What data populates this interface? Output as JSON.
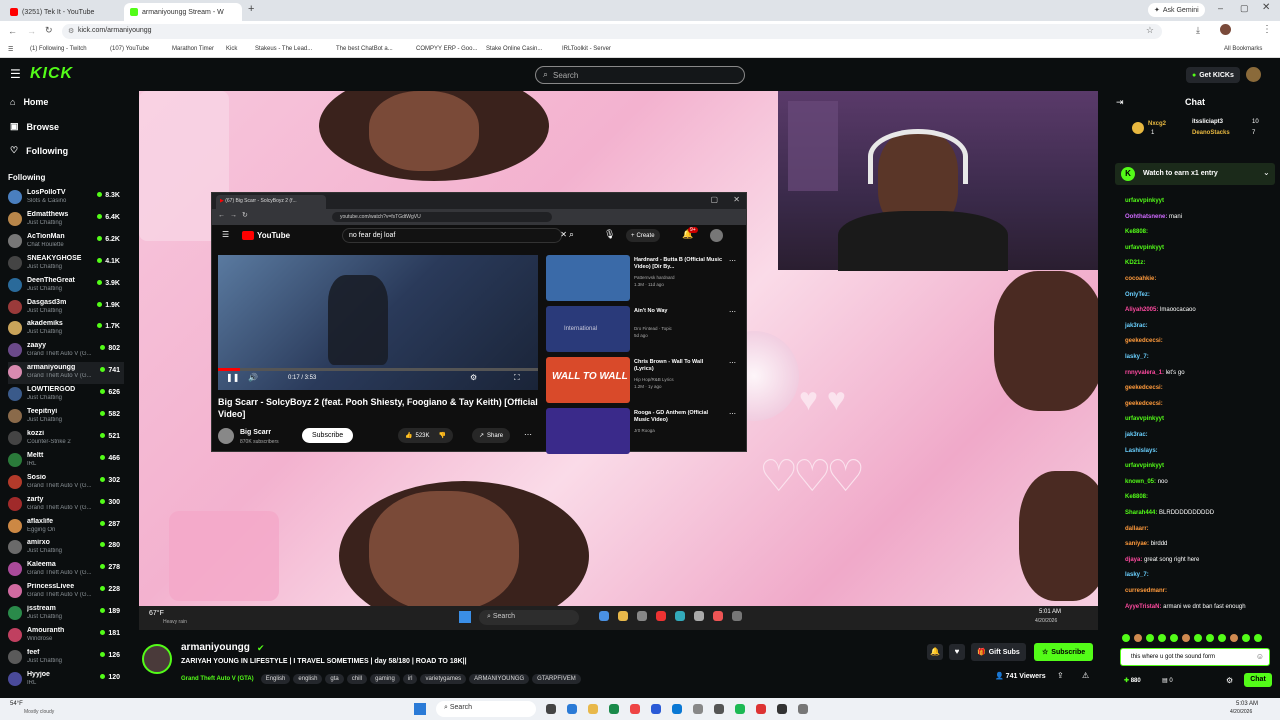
{
  "browser": {
    "tabs": [
      {
        "label": "(3251) Tek It - YouTube"
      },
      {
        "label": "armaniyoungg Stream - W"
      }
    ],
    "new_tab": "+",
    "ask_gemini": "Ask Gemini",
    "url": "kick.com/armaniyoungg",
    "bookmarks": [
      "(1) Following - Twitch",
      "(107) YouTube",
      "Marathon Timer",
      "Kick",
      "Stakeus - The Lead...",
      "The best ChatBot a...",
      "COMPYY ERP - Goo...",
      "Stake Online Casin...",
      "IRLToolkit - Server"
    ],
    "all_bookmarks": "All Bookmarks"
  },
  "kick": {
    "logo": "KICK",
    "search_placeholder": "Search",
    "get_kicks": "Get KICKs"
  },
  "sidebar": {
    "nav": [
      {
        "label": "Home",
        "icon": "home-icon"
      },
      {
        "label": "Browse",
        "icon": "browse-icon"
      },
      {
        "label": "Following",
        "icon": "heart-icon"
      }
    ],
    "following_title": "Following",
    "channels": [
      {
        "name": "LosPolloTV",
        "game": "Slots & Casino",
        "viewers": "8.3K",
        "color": "#4a7fbf"
      },
      {
        "name": "Edmatthews",
        "game": "Just Chatting",
        "viewers": "6.4K",
        "color": "#b8864a"
      },
      {
        "name": "AcTionMan",
        "game": "Chat Roulette",
        "viewers": "6.2K",
        "color": "#777"
      },
      {
        "name": "SNEAKYGHOSE",
        "game": "Just Chatting",
        "viewers": "4.1K",
        "color": "#444"
      },
      {
        "name": "DeenTheGreat",
        "game": "Just Chatting",
        "viewers": "3.9K",
        "color": "#2a6a9a"
      },
      {
        "name": "Dasgasd3m",
        "game": "Just Chatting",
        "viewers": "1.9K",
        "color": "#9a3a3a"
      },
      {
        "name": "akademiks",
        "game": "Just Chatting",
        "viewers": "1.7K",
        "color": "#c9a45a"
      },
      {
        "name": "zaayy",
        "game": "Grand Theft Auto V (G...",
        "viewers": "802",
        "color": "#6b4a8a"
      },
      {
        "name": "armaniyoungg",
        "game": "Grand Theft Auto V (G...",
        "viewers": "741",
        "color": "#d88ab0"
      },
      {
        "name": "LOWTIERGOD",
        "game": "Just Chatting",
        "viewers": "626",
        "color": "#3a5a8a"
      },
      {
        "name": "Teepitnyi",
        "game": "Just Chatting",
        "viewers": "582",
        "color": "#8a6a4a"
      },
      {
        "name": "kozzi",
        "game": "Counter-Strike 2",
        "viewers": "521",
        "color": "#444"
      },
      {
        "name": "Meltt",
        "game": "IRL",
        "viewers": "466",
        "color": "#2a7a3a"
      },
      {
        "name": "Sosio",
        "game": "Grand Theft Auto V (G...",
        "viewers": "302",
        "color": "#b23a2a"
      },
      {
        "name": "zarty",
        "game": "Grand Theft Auto V (G...",
        "viewers": "300",
        "color": "#a02a2a"
      },
      {
        "name": "aflaxlife",
        "game": "Egging On",
        "viewers": "287",
        "color": "#cc8844"
      },
      {
        "name": "amirxo",
        "game": "Just Chatting",
        "viewers": "280",
        "color": "#6a6a6a"
      },
      {
        "name": "Kaleema",
        "game": "Grand Theft Auto V (G...",
        "viewers": "278",
        "color": "#aa4a9a"
      },
      {
        "name": "PrincessLivee",
        "game": "Grand Theft Auto V (G...",
        "viewers": "228",
        "color": "#d06aa0"
      },
      {
        "name": "jsstream",
        "game": "Just Chatting",
        "viewers": "189",
        "color": "#2a8a4a"
      },
      {
        "name": "Amouranth",
        "game": "Windrose",
        "viewers": "181",
        "color": "#c04060"
      },
      {
        "name": "feef",
        "game": "Just Chatting",
        "viewers": "126",
        "color": "#5a5a5a"
      },
      {
        "name": "Hyyjoe",
        "game": "IRL",
        "viewers": "120",
        "color": "#4a4a9a"
      }
    ]
  },
  "overlay_window": {
    "tab_title": "(67) Big Scarr - SolcyBoyz 2 (f...",
    "url": "youtube.com/watch?v=fsTGdtWgVU",
    "yt_logo": "YouTube",
    "search_query": "no fear dej loaf",
    "create_label": "Create",
    "notif_count": "9+",
    "video_time": "0:17 / 3:53",
    "video_title": "Big Scarr - SolcyBoyz 2 (feat. Pooh Shiesty, Foogiano & Tay Keith) [Official Video]",
    "channel": "Big Scarr",
    "subscribers": "870K subscribers",
    "subscribe": "Subscribe",
    "likes": "523K",
    "share": "Share",
    "recs": [
      {
        "title": "Hardnard - Butta B (Official Music Video) [Dir By...",
        "meta": "Patternvsk hardnard",
        "stats": "1.3M · 11d ago",
        "thumb": "#3a6aa8"
      },
      {
        "title": "Ain't No Way",
        "meta": "Dro Fintead · Topic",
        "stats": "5d ago",
        "thumb": "#2a3a7a"
      },
      {
        "title": "Chris Brown - Wall To Wall (Lyrics)",
        "meta": "Hip Hop/R&B Lyrics",
        "stats": "1.2M · 1y ago",
        "thumb": "#d94a2a"
      },
      {
        "title": "Rooga - GD Anthem (Official Music Video)",
        "meta": "Jr0 Rooga",
        "stats": "",
        "thumb": "#3a2a8a"
      }
    ],
    "wall_text": "WALL TO WALL",
    "international": "International"
  },
  "stream_taskbar": {
    "weather": "67°F",
    "weather_desc": "Heavy rain",
    "search": "Search",
    "time": "5:01 AM",
    "date": "4/20/2026"
  },
  "chat": {
    "title": "Chat",
    "pinned": [
      {
        "name": "Nxcg2",
        "gifts": "1"
      },
      {
        "name": "itssliciapt3",
        "gifts": "10"
      },
      {
        "name": "DeanoStacks",
        "gifts": "7"
      }
    ],
    "banner": "Watch to earn x1 entry",
    "messages": [
      {
        "user": "urfavvpinkyyt",
        "text": "",
        "color": "#53fc18"
      },
      {
        "user": "Oohthatsnene:",
        "text": "mani",
        "color": "#d06aff"
      },
      {
        "user": "Ke8808:",
        "text": "",
        "color": "#53fc18"
      },
      {
        "user": "urfavvpinkyyt",
        "text": "",
        "color": "#53fc18"
      },
      {
        "user": "KD21z:",
        "text": "",
        "color": "#53fc18"
      },
      {
        "user": "cocoahkie:",
        "text": "",
        "color": "#ff9a3c"
      },
      {
        "user": "OnlyTez:",
        "text": "",
        "color": "#6ad0ff"
      },
      {
        "user": "Aliyah2005:",
        "text": "lmaoocacaoo",
        "color": "#ff4aa0"
      },
      {
        "user": "jak3rac:",
        "text": "",
        "color": "#6ad0ff"
      },
      {
        "user": "geekedcecsi:",
        "text": "",
        "color": "#ff9a3c"
      },
      {
        "user": "lasky_7:",
        "text": "",
        "color": "#6ad0ff"
      },
      {
        "user": "rnnyvalera_1:",
        "text": "let's go",
        "color": "#ff4aa0"
      },
      {
        "user": "geekedcecsi:",
        "text": "",
        "color": "#ff9a3c"
      },
      {
        "user": "geekedcecsi:",
        "text": "",
        "color": "#ff9a3c"
      },
      {
        "user": "urfavvpinkyyt",
        "text": "",
        "color": "#53fc18"
      },
      {
        "user": "jak3rac:",
        "text": "",
        "color": "#6ad0ff"
      },
      {
        "user": "Lashislays:",
        "text": "",
        "color": "#6ad0ff"
      },
      {
        "user": "urfavvpinkyyt",
        "text": "",
        "color": "#53fc18"
      },
      {
        "user": "known_05:",
        "text": "noo",
        "color": "#53fc18"
      },
      {
        "user": "Ke8808:",
        "text": "",
        "color": "#53fc18"
      },
      {
        "user": "Sharah444:",
        "text": "BLRDDDDDDDDDD",
        "color": "#53fc18"
      },
      {
        "user": "dallaarr:",
        "text": "",
        "color": "#ff9a3c"
      },
      {
        "user": "saniyae:",
        "text": "birddd",
        "color": "#ff9a3c"
      },
      {
        "user": "djaya:",
        "text": "great song right here",
        "color": "#ff4aa0"
      },
      {
        "user": "lasky_7:",
        "text": "",
        "color": "#6ad0ff"
      },
      {
        "user": "curresedmanr:",
        "text": "",
        "color": "#ff9a3c"
      },
      {
        "user": "AyyeTristaN:",
        "text": "armani we dnt ban fast enough",
        "color": "#ff4aa0"
      }
    ],
    "input_value": "this where u got the sound form",
    "kicks": "880",
    "count": "0",
    "chat_button": "Chat"
  },
  "info": {
    "streamer": "armaniyoungg",
    "title": "ZARIYAH YOUNG IN LIFESTYLE | I TRAVEL SOMETIMES | day 58/180 | ROAD TO 18K||",
    "category": "Grand Theft Auto V (GTA)",
    "tags": [
      "English",
      "english",
      "gta",
      "chill",
      "gaming",
      "irl",
      "varietygames",
      "ARMANIYOUNGG",
      "GTARPFIVEM"
    ],
    "gift_subs": "Gift Subs",
    "subscribe": "Subscribe",
    "viewers": "741 Viewers"
  },
  "taskbar": {
    "weather": "54°F",
    "weather_desc": "Mostly cloudy",
    "search": "Search",
    "time": "5:03 AM",
    "date": "4/20/2026"
  }
}
